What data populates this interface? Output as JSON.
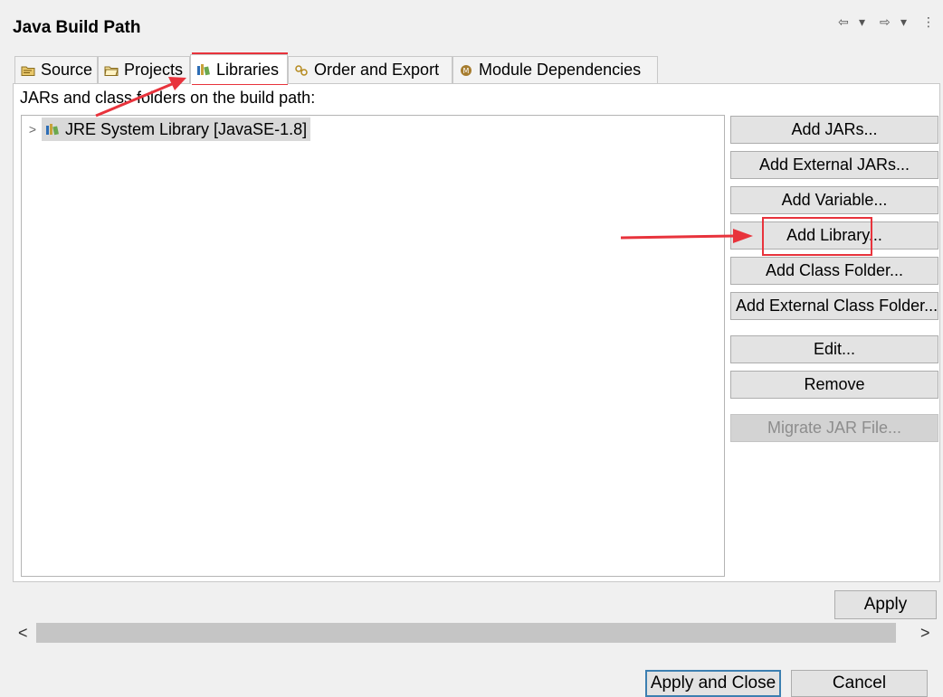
{
  "window": {
    "title": "Java Build Path"
  },
  "nav": {
    "back_icon": "⇦",
    "forward_icon": "⇨",
    "dropdown_icon": "▾",
    "menu_icon": "⋮"
  },
  "tabs": [
    {
      "label": "Source",
      "icon": "source-folder-icon"
    },
    {
      "label": "Projects",
      "icon": "projects-folder-icon"
    },
    {
      "label": "Libraries",
      "icon": "libraries-icon",
      "active": true
    },
    {
      "label": "Order and Export",
      "icon": "order-export-icon"
    },
    {
      "label": "Module Dependencies",
      "icon": "module-icon"
    }
  ],
  "panel": {
    "caption": "JARs and class folders on the build path:",
    "tree": [
      {
        "label": "JRE System Library [JavaSE-1.8]",
        "expand_icon": ">"
      }
    ]
  },
  "buttons": [
    {
      "label": "Add JARs...",
      "enabled": true
    },
    {
      "label": "Add External JARs...",
      "enabled": true
    },
    {
      "label": "Add Variable...",
      "enabled": true
    },
    {
      "label": "Add Library...",
      "enabled": true
    },
    {
      "label": "Add Class Folder...",
      "enabled": true
    },
    {
      "label": "Add External Class Folder...",
      "enabled": true
    },
    {
      "label": "Edit...",
      "enabled": true
    },
    {
      "label": "Remove",
      "enabled": true
    },
    {
      "label": "Migrate JAR File...",
      "enabled": false
    }
  ],
  "footer": {
    "apply": "Apply",
    "apply_and_close": "Apply and Close",
    "cancel": "Cancel"
  },
  "scroll": {
    "left": "<",
    "right": ">"
  },
  "colors": {
    "annotation_red": "#e8333c",
    "selection_gray": "#d9d9d9",
    "default_button_border": "#3c7fb1"
  }
}
